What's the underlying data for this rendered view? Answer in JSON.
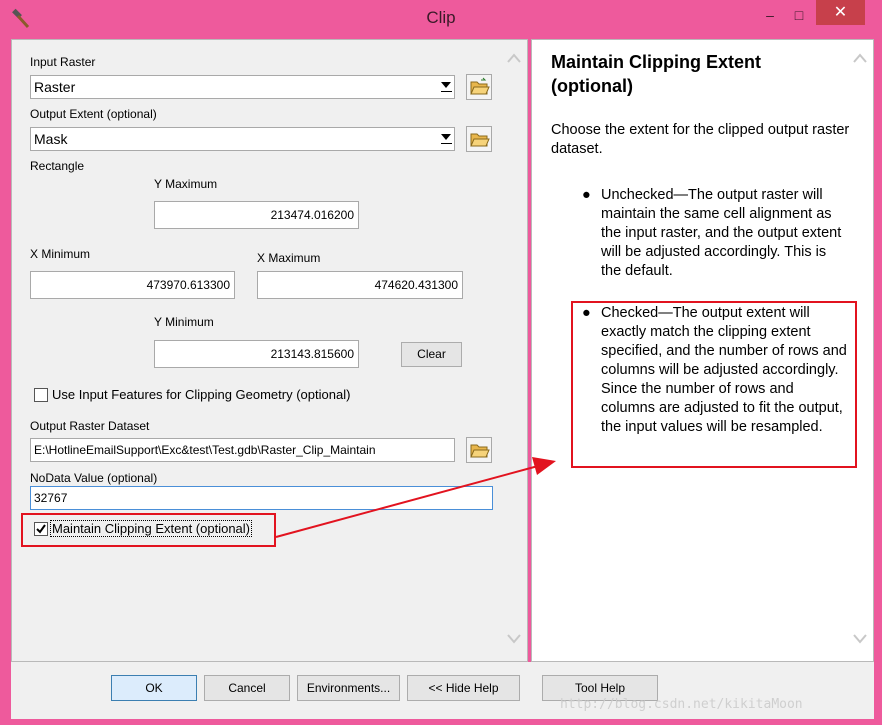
{
  "window": {
    "title": "Clip",
    "minimize_glyph": "–",
    "maximize_glyph": "□",
    "close_glyph": "✕"
  },
  "form": {
    "input_raster_label": "Input Raster",
    "input_raster_value": "Raster",
    "output_extent_label": "Output Extent (optional)",
    "output_extent_value": "Mask",
    "rectangle_label": "Rectangle",
    "y_max_label": "Y Maximum",
    "y_max_value": "213474.016200",
    "x_min_label": "X Minimum",
    "x_min_value": "473970.613300",
    "x_max_label": "X Maximum",
    "x_max_value": "474620.431300",
    "y_min_label": "Y Minimum",
    "y_min_value": "213143.815600",
    "clear_label": "Clear",
    "use_input_features_label": "Use Input Features for Clipping Geometry (optional)",
    "use_input_features_checked": false,
    "output_dataset_label": "Output Raster Dataset",
    "output_dataset_value": "E:\\HotlineEmailSupport\\Exc&test\\Test.gdb\\Raster_Clip_Maintain",
    "nodata_label": "NoData Value (optional)",
    "nodata_value": "32767",
    "maintain_extent_label": "Maintain Clipping Extent (optional)",
    "maintain_extent_checked": true
  },
  "help": {
    "title": "Maintain Clipping Extent (optional)",
    "intro": "Choose the extent for the clipped output raster dataset.",
    "bullets": [
      "Unchecked—The output raster will maintain the same cell alignment as the input raster, and the output extent will be adjusted accordingly. This is the default.",
      "Checked—The output extent will exactly match the clipping extent specified, and the number of rows and columns will be adjusted accordingly. Since the number of rows and columns are adjusted to fit the output, the input values will be resampled."
    ]
  },
  "footer": {
    "ok_label": "OK",
    "cancel_label": "Cancel",
    "environments_label": "Environments...",
    "hide_help_label": "<< Hide Help",
    "tool_help_label": "Tool Help"
  },
  "watermark": "http://blog.csdn.net/kikitaMoon",
  "colors": {
    "title_bar": "#ee5a9c",
    "annotation_red": "#e2131f",
    "close_button": "#c7404b"
  },
  "icons": {
    "app": "hammer-icon",
    "browse": "folder-open-icon",
    "scroll_up": "chevron-up-icon",
    "scroll_down": "chevron-down-icon"
  }
}
